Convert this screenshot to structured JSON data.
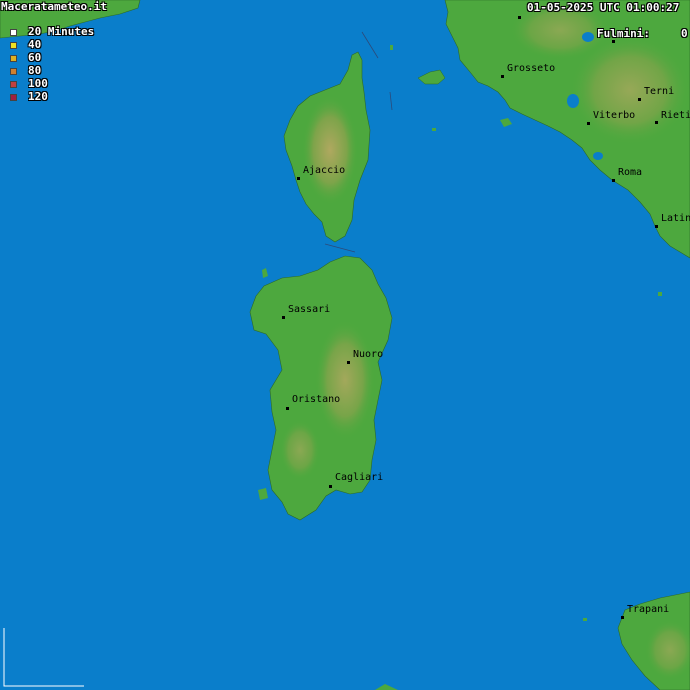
{
  "header": {
    "site": "Maceratameteo.it",
    "datetime": "01-05-2025 UTC 01:00:27",
    "lightning_label": "Fulmini:",
    "lightning_count": "0"
  },
  "legend": [
    {
      "label": "20 Minutes",
      "color": "#ffffff"
    },
    {
      "label": "40",
      "color": "#f0e020"
    },
    {
      "label": "60",
      "color": "#e0b020"
    },
    {
      "label": "80",
      "color": "#d08030"
    },
    {
      "label": "100",
      "color": "#c04040"
    },
    {
      "label": "120",
      "color": "#a02040"
    }
  ],
  "cities": {
    "grosseto": "Grosseto",
    "terni": "Terni",
    "viterbo": "Viterbo",
    "rieti": "Rieti",
    "roma": "Roma",
    "latina": "Latin",
    "ajaccio": "Ajaccio",
    "sassari": "Sassari",
    "nuoro": "Nuoro",
    "oristano": "Oristano",
    "cagliari": "Cagliari",
    "trapani": "Trapani"
  },
  "colors": {
    "sea": "#0a7ecb",
    "land": "#4da83e",
    "relief": "#b79a5a"
  }
}
